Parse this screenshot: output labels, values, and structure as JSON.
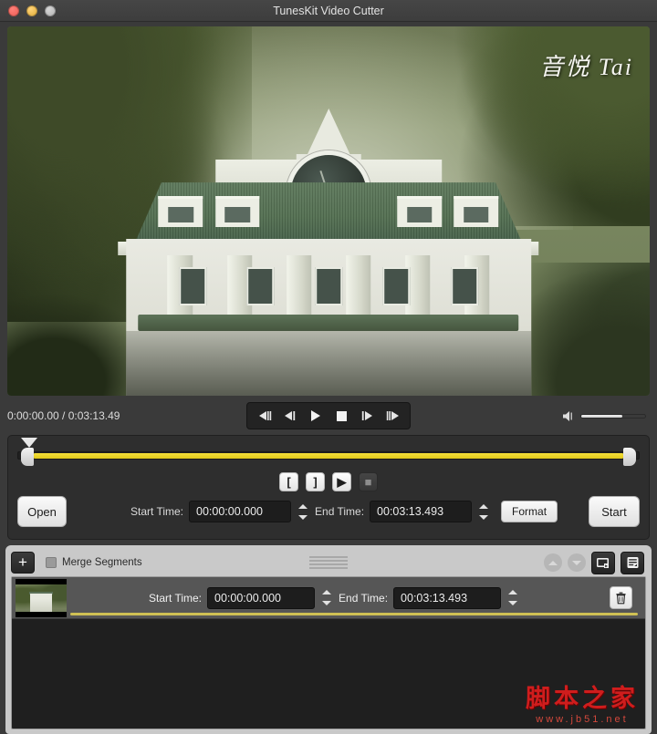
{
  "window": {
    "title": "TunesKit Video Cutter",
    "traffic_lights": [
      "close",
      "minimize",
      "zoom"
    ]
  },
  "video": {
    "watermark": "音悦 Tai",
    "scene_description": "clock tower building with green roof framed by trees"
  },
  "transport": {
    "timecode": "0:00:00.00 / 0:03:13.49",
    "current_time": "0:00:00.00",
    "total_time": "0:03:13.49",
    "buttons": [
      {
        "name": "step-back-frame-button",
        "icon": "prev-frame-icon"
      },
      {
        "name": "rewind-button",
        "icon": "rewind-icon"
      },
      {
        "name": "play-button",
        "icon": "play-icon"
      },
      {
        "name": "stop-button",
        "icon": "stop-icon"
      },
      {
        "name": "fast-forward-button",
        "icon": "forward-icon"
      },
      {
        "name": "step-forward-frame-button",
        "icon": "next-frame-icon"
      }
    ],
    "volume": {
      "icon": "volume-icon",
      "level_percent": 64
    }
  },
  "trim": {
    "selection_color": "#f0d91e",
    "playhead_position_percent": 0,
    "mark_buttons": [
      {
        "name": "set-start-marker-button",
        "label": "[",
        "style": "light"
      },
      {
        "name": "set-end-marker-button",
        "label": "]",
        "style": "light"
      },
      {
        "name": "preview-segment-button",
        "label": "▶",
        "style": "light"
      },
      {
        "name": "stop-preview-button",
        "label": "■",
        "style": "dark"
      }
    ]
  },
  "actions": {
    "open_label": "Open",
    "start_label": "Start",
    "format_label": "Format",
    "start_time_label": "Start Time:",
    "start_time_value": "00:00:00.000",
    "end_time_label": "End Time:",
    "end_time_value": "00:03:13.493"
  },
  "segments_panel": {
    "add_label": "+",
    "merge_label": "Merge Segments",
    "merge_checked": false,
    "move_up_icon": "chevron-up-icon",
    "move_down_icon": "chevron-down-icon",
    "open_folder_icon": "folder-icon",
    "history_icon": "list-icon",
    "rows": [
      {
        "thumbnail": "video-thumbnail",
        "start_time_label": "Start Time:",
        "start_time_value": "00:00:00.000",
        "end_time_label": "End Time:",
        "end_time_value": "00:03:13.493",
        "delete_icon": "trash-icon"
      }
    ]
  },
  "watermark": {
    "cn_text": "脚本之家",
    "url_text": "www.jb51.net"
  },
  "colors": {
    "accent_yellow": "#f0d91e",
    "window_bg": "#3a3a3a",
    "panel_bg": "#2e2e2e",
    "segments_bg": "#c9c9c9",
    "watermark_red": "#cf1d1d"
  }
}
